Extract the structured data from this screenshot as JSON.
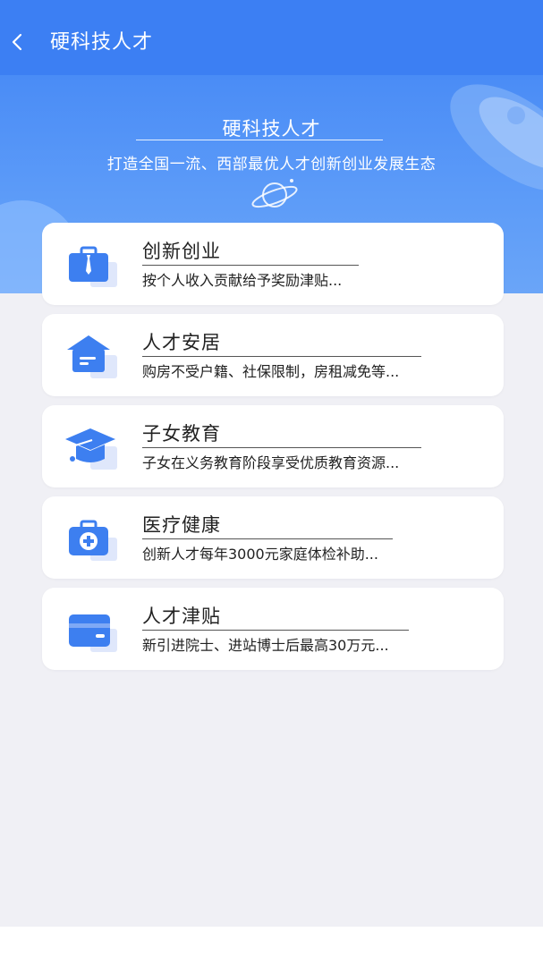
{
  "header": {
    "title": "硬科技人才"
  },
  "banner": {
    "title": "硬科技人才",
    "subtitle": "打造全国一流、西部最优人才创新创业发展生态"
  },
  "cards": [
    {
      "title": "创新创业",
      "desc": "按个人收入贡献给予奖励津贴...",
      "icon": "briefcase-tie-icon"
    },
    {
      "title": "人才安居",
      "desc": "购房不受户籍、社保限制，房租减免等...",
      "icon": "house-icon"
    },
    {
      "title": "子女教育",
      "desc": "子女在义务教育阶段享受优质教育资源...",
      "icon": "graduation-cap-icon"
    },
    {
      "title": "医疗健康",
      "desc": "创新人才每年3000元家庭体检补助...",
      "icon": "medical-kit-icon"
    },
    {
      "title": "人才津贴",
      "desc": "新引进院士、进站博士后最高30万元...",
      "icon": "card-icon"
    }
  ],
  "colors": {
    "primary": "#3c7ff3",
    "icon_blue": "#3d7ff0",
    "icon_light": "#dfe7fb",
    "background": "#f0f0f5"
  }
}
